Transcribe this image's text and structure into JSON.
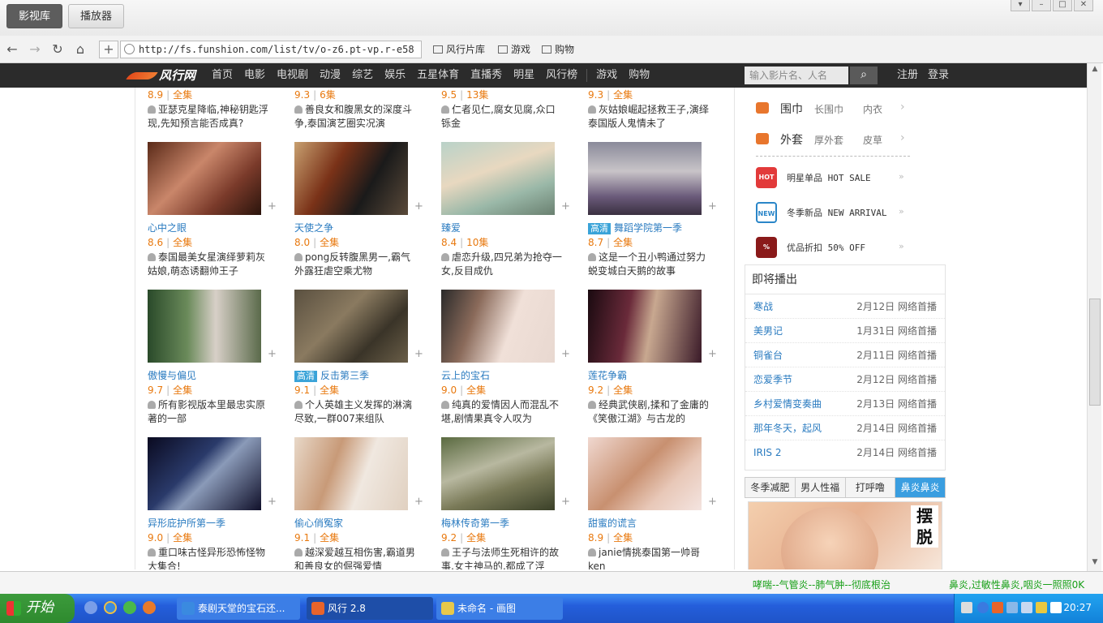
{
  "browser": {
    "tab_active": "影视库",
    "tab_inactive": "播放器",
    "url": "http://fs.funshion.com/list/tv/o-z6.pt-vp.r-e58",
    "bookmarks": [
      "风行片库",
      "游戏",
      "购物"
    ]
  },
  "site": {
    "logo": "风行网",
    "nav": [
      "首页",
      "电影",
      "电视剧",
      "动漫",
      "综艺",
      "娱乐",
      "五星体育",
      "直播秀",
      "明星",
      "风行榜",
      "游戏",
      "购物"
    ],
    "search_placeholder": "输入影片名、人名",
    "register": "注册",
    "login": "登录"
  },
  "top_row": [
    {
      "score": "8.9",
      "episodes": "全集",
      "desc": "亚瑟克星降临,神秘钥匙浮现,先知预言能否成真?"
    },
    {
      "score": "9.3",
      "episodes": "6集",
      "desc": "善良女和腹黑女的深度斗争,泰国演艺圈实况演"
    },
    {
      "score": "9.5",
      "episodes": "13集",
      "desc": "仁者见仁,腐女见腐,众口铄金"
    },
    {
      "score": "9.3",
      "episodes": "全集",
      "desc": "灰姑娘崛起拯救王子,演绎泰国版人鬼情未了"
    }
  ],
  "items": [
    {
      "title": "心中之眼",
      "hd": "",
      "score": "8.6",
      "episodes": "全集",
      "desc": "泰国最美女星演绎萝莉灰姑娘,萌态诱翻帅王子"
    },
    {
      "title": "天使之争",
      "hd": "",
      "score": "8.0",
      "episodes": "全集",
      "desc": "pong反转腹黑男一,霸气外露狂虐空乘尤物"
    },
    {
      "title": "臻爱",
      "hd": "",
      "score": "8.4",
      "episodes": "10集",
      "desc": "虐恋升级,四兄弟为抢夺一女,反目成仇"
    },
    {
      "title": "舞蹈学院第一季",
      "hd": "高清",
      "score": "8.7",
      "episodes": "全集",
      "desc": "这是一个丑小鸭通过努力蜕变城白天鹅的故事"
    },
    {
      "title": "傲慢与偏见",
      "hd": "",
      "score": "9.7",
      "episodes": "全集",
      "desc": "所有影视版本里最忠实原著的一部"
    },
    {
      "title": "反击第三季",
      "hd": "高清",
      "score": "9.1",
      "episodes": "全集",
      "desc": "个人英雄主义发挥的淋漓尽致,一群007来组队"
    },
    {
      "title": "云上的宝石",
      "hd": "",
      "score": "9.0",
      "episodes": "全集",
      "desc": "纯真的爱情因人而混乱不堪,剧情果真令人叹为"
    },
    {
      "title": "莲花争霸",
      "hd": "",
      "score": "9.2",
      "episodes": "全集",
      "desc": "经典武侠剧,揉和了金庸的《笑傲江湖》与古龙的"
    },
    {
      "title": "异形庇护所第一季",
      "hd": "",
      "score": "9.0",
      "episodes": "全集",
      "desc": "重口味古怪异形恐怖怪物大集合!"
    },
    {
      "title": "偷心俏冤家",
      "hd": "",
      "score": "9.1",
      "episodes": "全集",
      "desc": "越深爱越互相伤害,霸道男和善良女的倔强爱情"
    },
    {
      "title": "梅林传奇第一季",
      "hd": "",
      "score": "9.2",
      "episodes": "全集",
      "desc": "王子与法师生死相许的故事,女主神马的,都成了浮"
    },
    {
      "title": "甜蜜的谎言",
      "hd": "",
      "score": "8.9",
      "episodes": "全集",
      "desc": "janie情挑泰国第一帅哥ken"
    }
  ],
  "sidebar": {
    "categories": [
      {
        "name": "围巾",
        "a": "长围巾",
        "b": "内衣"
      },
      {
        "name": "外套",
        "a": "厚外套",
        "b": "皮草"
      }
    ],
    "promos": [
      {
        "icon": "HOT",
        "text": "明星单品 HOT SALE",
        "color": "#e23a3a"
      },
      {
        "icon": "NEW",
        "text": "冬季新品 NEW ARRIVAL",
        "color": "#2a86c8"
      },
      {
        "icon": "%",
        "text": "优品折扣 50% OFF",
        "color": "#8a1a1a"
      }
    ],
    "upcoming_title": "即将播出",
    "upcoming": [
      {
        "name": "寒战",
        "date": "2月12日 网络首播"
      },
      {
        "name": "美男记",
        "date": "1月31日 网络首播"
      },
      {
        "name": "铜雀台",
        "date": "2月11日 网络首播"
      },
      {
        "name": "恋爱季节",
        "date": "2月12日 网络首播"
      },
      {
        "name": "乡村爱情变奏曲",
        "date": "2月13日 网络首播"
      },
      {
        "name": "那年冬天，起风",
        "date": "2月14日 网络首播"
      },
      {
        "name": "IRIS 2",
        "date": "2月14日 网络首播"
      }
    ],
    "ad_tabs": [
      "冬季减肥",
      "男人性福",
      "打呼噜",
      "鼻炎鼻炎"
    ],
    "ad_text": "摆脱"
  },
  "status": {
    "msg1": "哮喘--气管炎--肺气肿--彻底根治",
    "msg2": "鼻炎,过敏性鼻炎,咽炎一照照0K"
  },
  "taskbar": {
    "start": "开始",
    "windows": [
      "泰剧天堂的宝石还...",
      "风行 2.8",
      "未命名 - 画图"
    ],
    "clock": "20:27"
  }
}
